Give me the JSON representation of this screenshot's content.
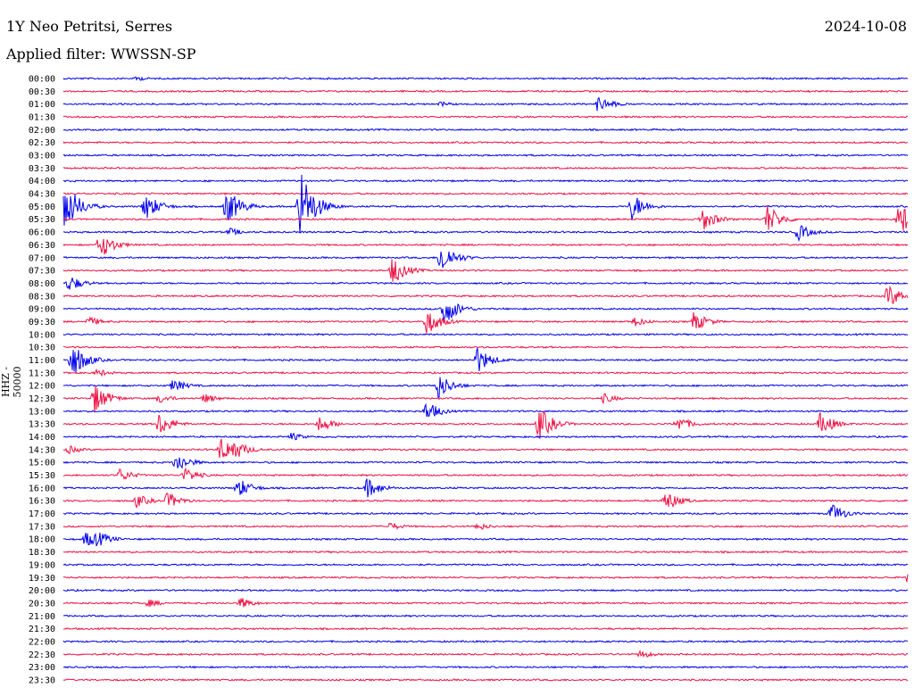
{
  "header": {
    "station": "1Y Neo Petritsi, Serres",
    "date": "2024-10-08",
    "filter": "Applied filter: WWSSN-SP",
    "ylabel": "HHZ - 50000"
  },
  "chart_data": {
    "type": "helicorder",
    "title": "1Y Neo Petritsi, Serres",
    "ylabel": "HHZ - 50000",
    "row_labels": [
      "00:00",
      "00:30",
      "01:00",
      "01:30",
      "02:00",
      "02:30",
      "03:00",
      "03:30",
      "04:00",
      "04:30",
      "05:00",
      "05:30",
      "06:00",
      "06:30",
      "07:00",
      "07:30",
      "08:00",
      "08:30",
      "09:00",
      "09:30",
      "10:00",
      "10:30",
      "11:00",
      "11:30",
      "12:00",
      "12:30",
      "13:00",
      "13:30",
      "14:00",
      "14:30",
      "15:00",
      "15:30",
      "16:00",
      "16:30",
      "17:00",
      "17:30",
      "18:00",
      "18:30",
      "19:00",
      "19:30",
      "20:00",
      "20:30",
      "21:00",
      "21:30",
      "22:00",
      "22:30",
      "23:00",
      "23:30"
    ],
    "trace_colors": [
      "#0000ee",
      "#ee1144"
    ],
    "events": [
      {
        "row": 0,
        "minute": 2.6,
        "amp": 3
      },
      {
        "row": 2,
        "minute": 13.4,
        "amp": 3
      },
      {
        "row": 2,
        "minute": 19.0,
        "amp": 10
      },
      {
        "row": 10,
        "minute": 0.0,
        "amp": 34
      },
      {
        "row": 10,
        "minute": 2.9,
        "amp": 17
      },
      {
        "row": 10,
        "minute": 5.8,
        "amp": 22
      },
      {
        "row": 10,
        "minute": 8.4,
        "amp": 45
      },
      {
        "row": 10,
        "minute": 20.2,
        "amp": 16
      },
      {
        "row": 11,
        "minute": 25.0,
        "amp": 18
      },
      {
        "row": 11,
        "minute": 22.7,
        "amp": 14
      },
      {
        "row": 11,
        "minute": 29.7,
        "amp": 20
      },
      {
        "row": 12,
        "minute": 5.9,
        "amp": 5
      },
      {
        "row": 12,
        "minute": 26.1,
        "amp": 10
      },
      {
        "row": 13,
        "minute": 1.3,
        "amp": 16
      },
      {
        "row": 14,
        "minute": 13.4,
        "amp": 20
      },
      {
        "row": 15,
        "minute": 11.7,
        "amp": 17
      },
      {
        "row": 16,
        "minute": 0.2,
        "amp": 10
      },
      {
        "row": 17,
        "minute": 29.3,
        "amp": 14
      },
      {
        "row": 18,
        "minute": 13.5,
        "amp": 20
      },
      {
        "row": 19,
        "minute": 0.9,
        "amp": 6
      },
      {
        "row": 19,
        "minute": 12.9,
        "amp": 16
      },
      {
        "row": 19,
        "minute": 20.3,
        "amp": 6
      },
      {
        "row": 19,
        "minute": 22.4,
        "amp": 12
      },
      {
        "row": 22,
        "minute": 0.3,
        "amp": 22
      },
      {
        "row": 22,
        "minute": 14.7,
        "amp": 16
      },
      {
        "row": 23,
        "minute": 1.2,
        "amp": 5
      },
      {
        "row": 24,
        "minute": 3.9,
        "amp": 8
      },
      {
        "row": 24,
        "minute": 13.3,
        "amp": 16
      },
      {
        "row": 25,
        "minute": 1.1,
        "amp": 18
      },
      {
        "row": 25,
        "minute": 3.4,
        "amp": 6
      },
      {
        "row": 25,
        "minute": 5.0,
        "amp": 6
      },
      {
        "row": 25,
        "minute": 19.2,
        "amp": 6
      },
      {
        "row": 26,
        "minute": 12.9,
        "amp": 12
      },
      {
        "row": 27,
        "minute": 3.4,
        "amp": 14
      },
      {
        "row": 27,
        "minute": 9.1,
        "amp": 10
      },
      {
        "row": 27,
        "minute": 16.9,
        "amp": 20
      },
      {
        "row": 27,
        "minute": 21.8,
        "amp": 10
      },
      {
        "row": 27,
        "minute": 26.9,
        "amp": 14
      },
      {
        "row": 28,
        "minute": 8.1,
        "amp": 5
      },
      {
        "row": 29,
        "minute": 0.2,
        "amp": 5
      },
      {
        "row": 29,
        "minute": 5.6,
        "amp": 16
      },
      {
        "row": 29,
        "minute": 6.0,
        "amp": 14
      },
      {
        "row": 30,
        "minute": 4.0,
        "amp": 12
      },
      {
        "row": 31,
        "minute": 2.0,
        "amp": 8
      },
      {
        "row": 31,
        "minute": 4.3,
        "amp": 8
      },
      {
        "row": 31,
        "minute": 4.4,
        "amp": 8
      },
      {
        "row": 32,
        "minute": 6.2,
        "amp": 12
      },
      {
        "row": 32,
        "minute": 10.8,
        "amp": 12
      },
      {
        "row": 33,
        "minute": 2.6,
        "amp": 8
      },
      {
        "row": 33,
        "minute": 3.7,
        "amp": 10
      },
      {
        "row": 33,
        "minute": 21.4,
        "amp": 12
      },
      {
        "row": 34,
        "minute": 27.3,
        "amp": 12
      },
      {
        "row": 35,
        "minute": 11.6,
        "amp": 5
      },
      {
        "row": 35,
        "minute": 14.7,
        "amp": 5
      },
      {
        "row": 36,
        "minute": 0.8,
        "amp": 10
      },
      {
        "row": 36,
        "minute": 1.2,
        "amp": 10
      },
      {
        "row": 39,
        "minute": 30.0,
        "amp": 10
      },
      {
        "row": 41,
        "minute": 3.0,
        "amp": 5
      },
      {
        "row": 41,
        "minute": 6.3,
        "amp": 7
      },
      {
        "row": 45,
        "minute": 20.5,
        "amp": 5
      }
    ]
  }
}
